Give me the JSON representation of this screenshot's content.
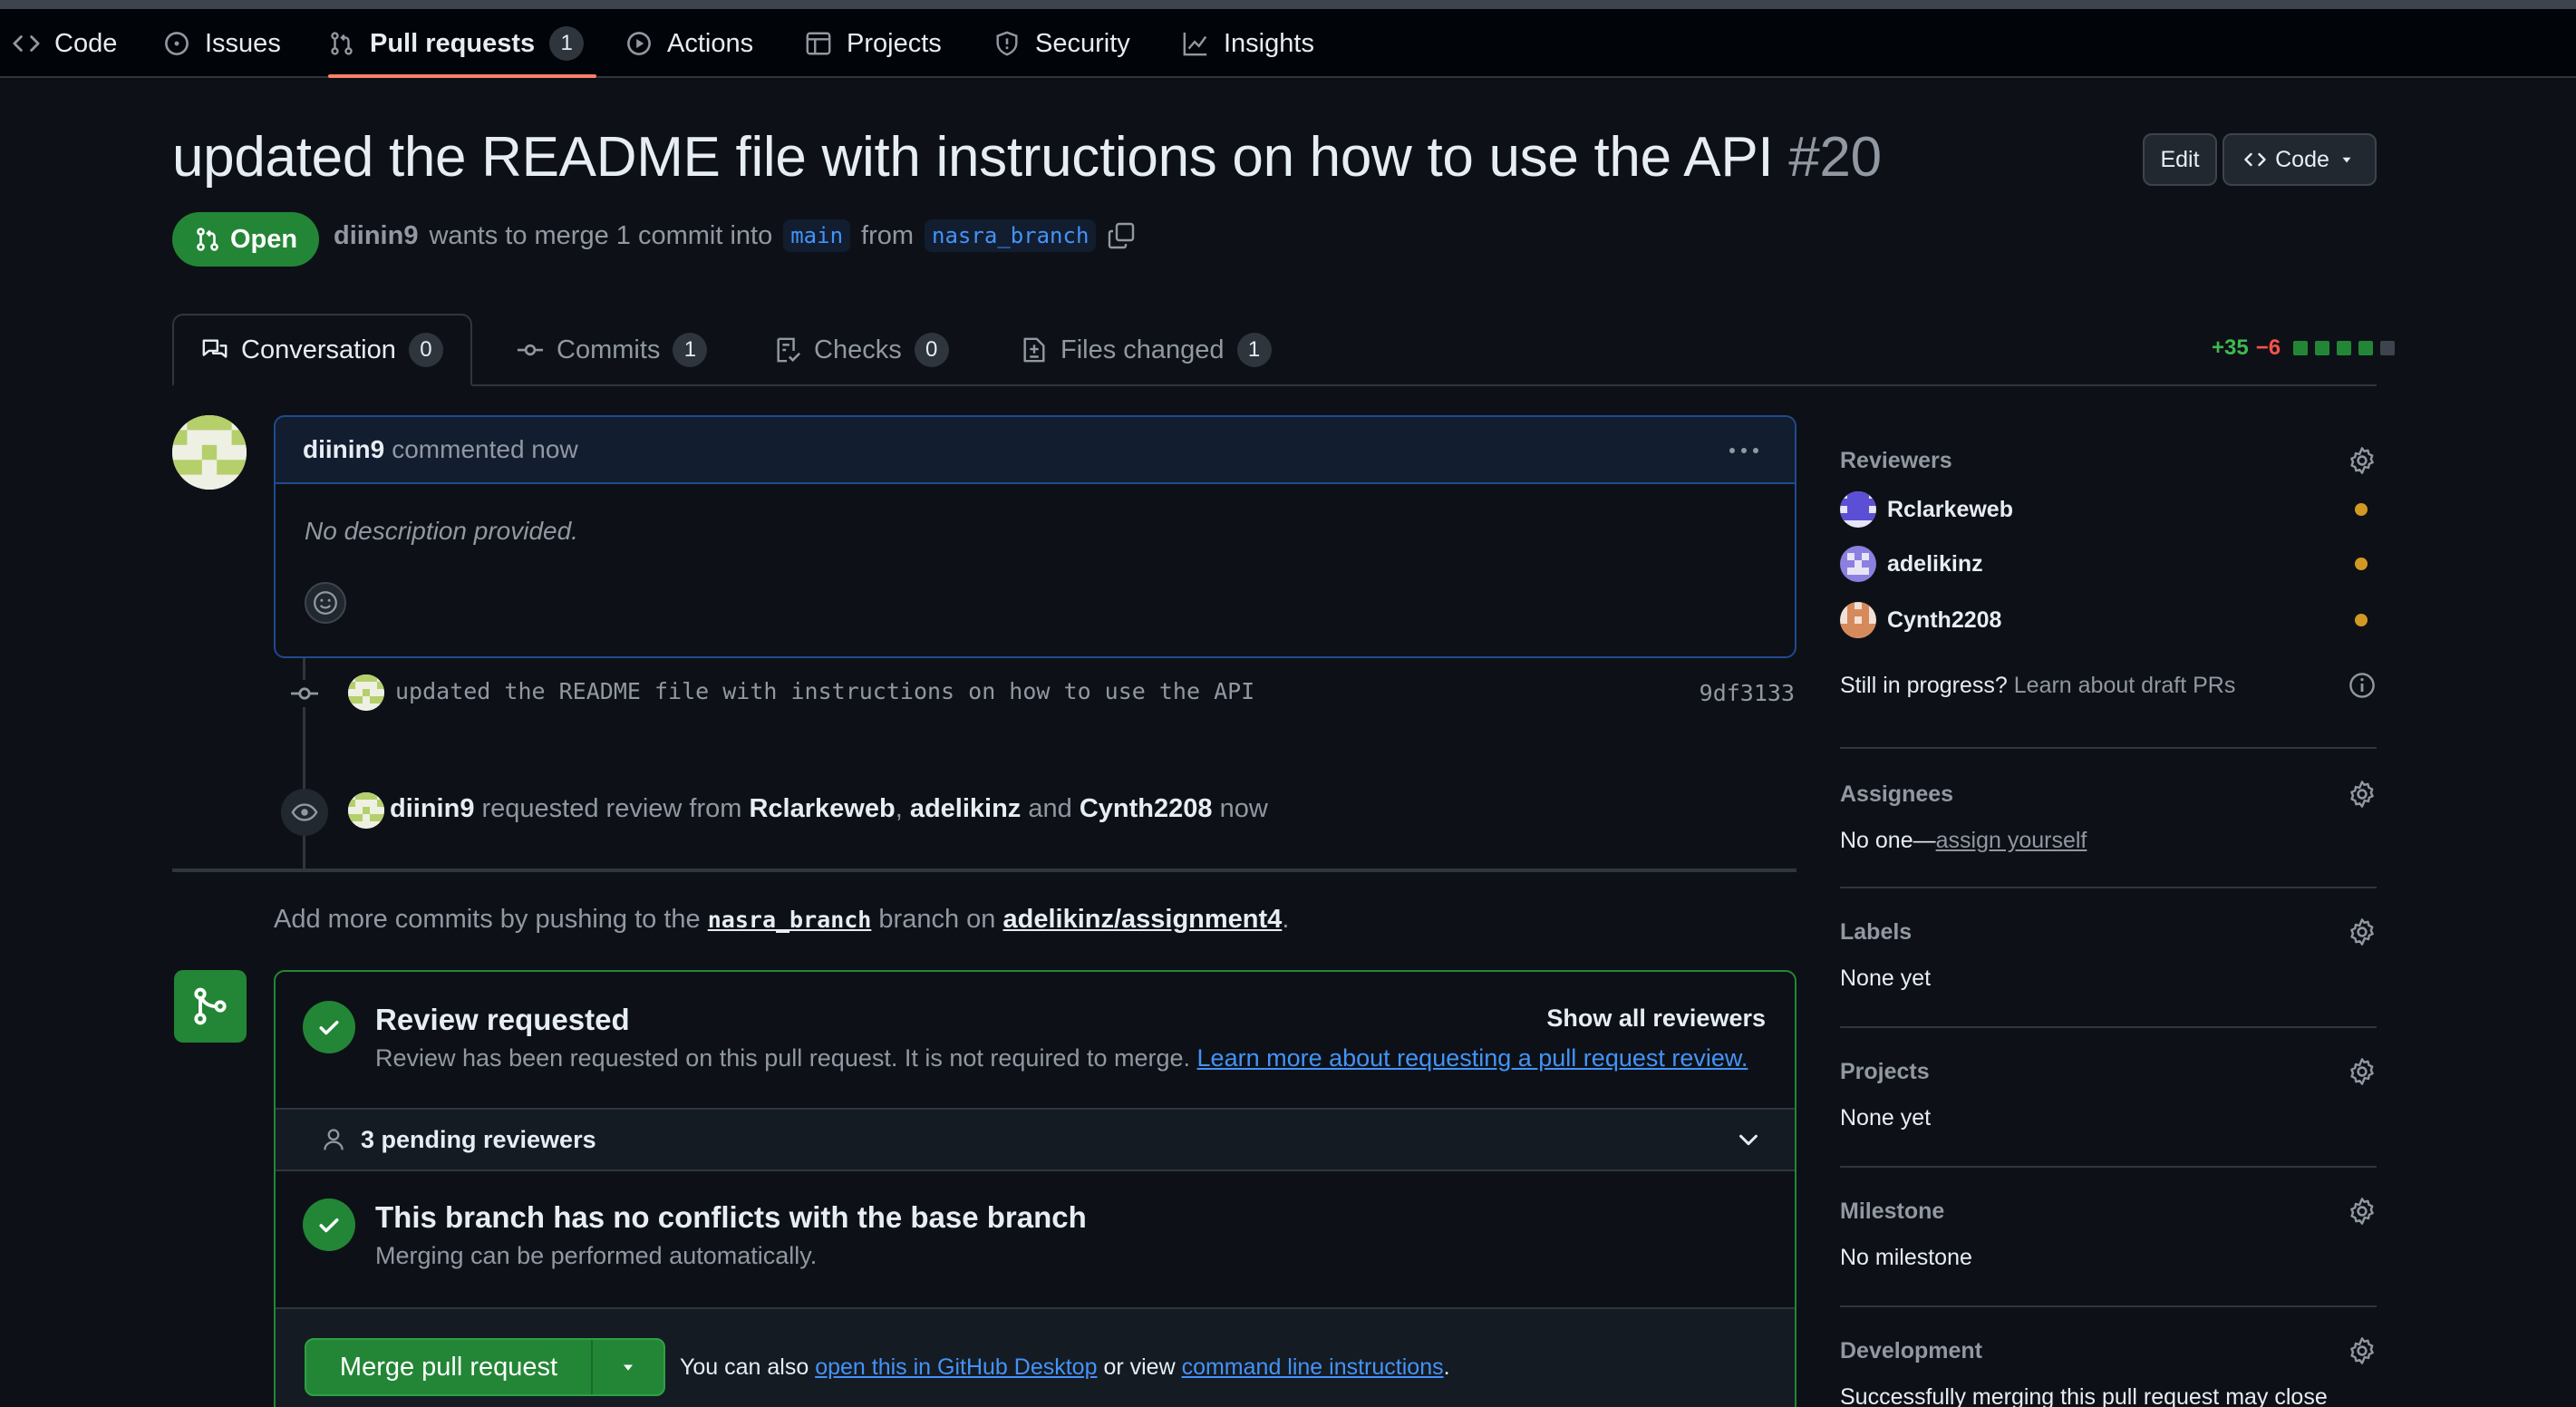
{
  "nav": {
    "code": "Code",
    "issues": "Issues",
    "pull_requests": "Pull requests",
    "pull_requests_count": "1",
    "actions": "Actions",
    "projects": "Projects",
    "security": "Security",
    "insights": "Insights"
  },
  "header": {
    "title": "updated the README file with instructions on how to use the API",
    "number": "#20",
    "edit_label": "Edit",
    "code_label": "Code",
    "state": "Open",
    "author": "diinin9",
    "merge_text": "wants to merge 1 commit into",
    "base_branch": "main",
    "from_text": "from",
    "head_branch": "nasra_branch"
  },
  "tabs": [
    {
      "label": "Conversation",
      "count": "0"
    },
    {
      "label": "Commits",
      "count": "1"
    },
    {
      "label": "Checks",
      "count": "0"
    },
    {
      "label": "Files changed",
      "count": "1"
    }
  ],
  "diffstat": {
    "additions": "+35",
    "deletions": "−6"
  },
  "comment": {
    "author": "diinin9",
    "action": "commented now",
    "body": "No description provided."
  },
  "commit": {
    "message": "updated the README file with instructions on how to use the API",
    "sha": "9df3133"
  },
  "review_event": {
    "actor": "diinin9",
    "text1": "requested review from",
    "reviewer1": "Rclarkeweb",
    "comma": ",",
    "reviewer2": "adelikinz",
    "and": "and",
    "reviewer3": "Cynth2208",
    "time": "now"
  },
  "push_hint": {
    "prefix": "Add more commits by pushing to the",
    "branch": "nasra_branch",
    "middle": "branch on",
    "repo": "adelikinz/assignment4",
    "suffix": "."
  },
  "merge_box": {
    "review_title": "Review requested",
    "review_sub": "Review has been requested on this pull request. It is not required to merge.",
    "review_link": "Learn more about requesting a pull request review.",
    "show_all": "Show all reviewers",
    "pending": "3 pending reviewers",
    "conflict_title": "This branch has no conflicts with the base branch",
    "conflict_sub": "Merging can be performed automatically.",
    "merge_button": "Merge pull request",
    "also_prefix": "You can also",
    "desktop_link": "open this in GitHub Desktop",
    "or_view": "or view",
    "cli_link": "command line instructions",
    "period": "."
  },
  "sidebar": {
    "reviewers_label": "Reviewers",
    "reviewers": [
      "Rclarkeweb",
      "adelikinz",
      "Cynth2208"
    ],
    "draft_q": "Still in progress?",
    "draft_link": "Learn about draft PRs",
    "assignees_label": "Assignees",
    "assignees_none": "No one—",
    "assign_link": "assign yourself",
    "labels_label": "Labels",
    "labels_value": "None yet",
    "projects_label": "Projects",
    "projects_value": "None yet",
    "milestone_label": "Milestone",
    "milestone_value": "No milestone",
    "development_label": "Development",
    "development_value": "Successfully merging this pull request may close"
  },
  "colors": {
    "accent_green": "#238636",
    "link_blue": "#4493f8",
    "pending_orange": "#d29922",
    "deletion_red": "#f85149"
  }
}
